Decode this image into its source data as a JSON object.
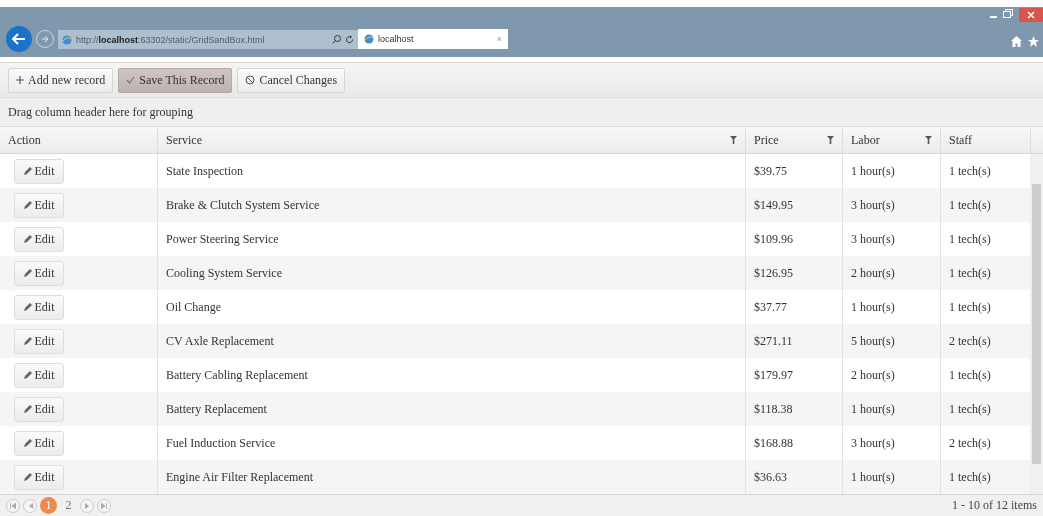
{
  "browser": {
    "address": "http://**localhost**:63302/static/GridSandBox.html",
    "tab": {
      "title": "localhost",
      "close": "×"
    }
  },
  "toolbar": [
    {
      "kind": "add",
      "label": "Add new record",
      "pressed": false
    },
    {
      "kind": "save",
      "label": "Save This Record",
      "pressed": true
    },
    {
      "kind": "cancel",
      "label": "Cancel Changes",
      "pressed": false
    }
  ],
  "grouping_hint": "Drag column header here for grouping",
  "table": {
    "columns": [
      {
        "label": "Action",
        "filter": false
      },
      {
        "label": "Service",
        "filter": true
      },
      {
        "label": "Price",
        "filter": true
      },
      {
        "label": "Labor",
        "filter": true
      },
      {
        "label": "Staff",
        "filter": false
      }
    ],
    "rows": [
      {
        "action": "Edit",
        "service": "State Inspection",
        "price": "$39.75",
        "labor": "1 hour(s)",
        "staff": "1 tech(s)"
      },
      {
        "action": "Edit",
        "service": "Brake & Clutch System Service",
        "price": "$149.95",
        "labor": "3 hour(s)",
        "staff": "1 tech(s)"
      },
      {
        "action": "Edit",
        "service": "Power Steering Service",
        "price": "$109.96",
        "labor": "3 hour(s)",
        "staff": "1 tech(s)"
      },
      {
        "action": "Edit",
        "service": "Cooling System Service",
        "price": "$126.95",
        "labor": "2 hour(s)",
        "staff": "1 tech(s)"
      },
      {
        "action": "Edit",
        "service": "Oil Change",
        "price": "$37.77",
        "labor": "1 hour(s)",
        "staff": "1 tech(s)"
      },
      {
        "action": "Edit",
        "service": "CV Axle Replacement",
        "price": "$271.11",
        "labor": "5 hour(s)",
        "staff": "2 tech(s)"
      },
      {
        "action": "Edit",
        "service": "Battery Cabling Replacement",
        "price": "$179.97",
        "labor": "2 hour(s)",
        "staff": "1 tech(s)"
      },
      {
        "action": "Edit",
        "service": "Battery Replacement",
        "price": "$118.38",
        "labor": "1 hour(s)",
        "staff": "1 tech(s)"
      },
      {
        "action": "Edit",
        "service": "Fuel Induction Service",
        "price": "$168.88",
        "labor": "3 hour(s)",
        "staff": "2 tech(s)"
      },
      {
        "action": "Edit",
        "service": "Engine Air Filter Replacement",
        "price": "$36.63",
        "labor": "1 hour(s)",
        "staff": "1 tech(s)"
      }
    ]
  },
  "pager": {
    "pages": [
      {
        "label": "1",
        "selected": true
      },
      {
        "label": "2",
        "selected": false
      }
    ],
    "summary": "1 - 10 of 12 items"
  }
}
